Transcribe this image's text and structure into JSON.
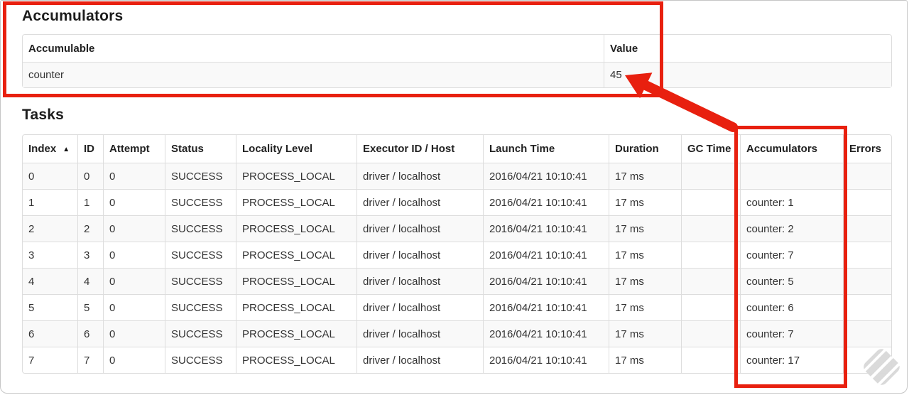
{
  "accumulators_section": {
    "title": "Accumulators",
    "table": {
      "headers": {
        "accumulable": "Accumulable",
        "value": "Value"
      },
      "rows": [
        {
          "accumulable": "counter",
          "value": "45"
        }
      ]
    }
  },
  "tasks_section": {
    "title": "Tasks",
    "table": {
      "headers": {
        "index": "Index",
        "id": "ID",
        "attempt": "Attempt",
        "status": "Status",
        "locality_level": "Locality Level",
        "executor_id_host": "Executor ID / Host",
        "launch_time": "Launch Time",
        "duration": "Duration",
        "gc_time": "GC Time",
        "accumulators": "Accumulators",
        "errors": "Errors"
      },
      "rows": [
        {
          "index": "0",
          "id": "0",
          "attempt": "0",
          "status": "SUCCESS",
          "locality_level": "PROCESS_LOCAL",
          "executor_id_host": "driver / localhost",
          "launch_time": "2016/04/21 10:10:41",
          "duration": "17 ms",
          "gc_time": "",
          "accumulators": "",
          "errors": ""
        },
        {
          "index": "1",
          "id": "1",
          "attempt": "0",
          "status": "SUCCESS",
          "locality_level": "PROCESS_LOCAL",
          "executor_id_host": "driver / localhost",
          "launch_time": "2016/04/21 10:10:41",
          "duration": "17 ms",
          "gc_time": "",
          "accumulators": "counter: 1",
          "errors": ""
        },
        {
          "index": "2",
          "id": "2",
          "attempt": "0",
          "status": "SUCCESS",
          "locality_level": "PROCESS_LOCAL",
          "executor_id_host": "driver / localhost",
          "launch_time": "2016/04/21 10:10:41",
          "duration": "17 ms",
          "gc_time": "",
          "accumulators": "counter: 2",
          "errors": ""
        },
        {
          "index": "3",
          "id": "3",
          "attempt": "0",
          "status": "SUCCESS",
          "locality_level": "PROCESS_LOCAL",
          "executor_id_host": "driver / localhost",
          "launch_time": "2016/04/21 10:10:41",
          "duration": "17 ms",
          "gc_time": "",
          "accumulators": "counter: 7",
          "errors": ""
        },
        {
          "index": "4",
          "id": "4",
          "attempt": "0",
          "status": "SUCCESS",
          "locality_level": "PROCESS_LOCAL",
          "executor_id_host": "driver / localhost",
          "launch_time": "2016/04/21 10:10:41",
          "duration": "17 ms",
          "gc_time": "",
          "accumulators": "counter: 5",
          "errors": ""
        },
        {
          "index": "5",
          "id": "5",
          "attempt": "0",
          "status": "SUCCESS",
          "locality_level": "PROCESS_LOCAL",
          "executor_id_host": "driver / localhost",
          "launch_time": "2016/04/21 10:10:41",
          "duration": "17 ms",
          "gc_time": "",
          "accumulators": "counter: 6",
          "errors": ""
        },
        {
          "index": "6",
          "id": "6",
          "attempt": "0",
          "status": "SUCCESS",
          "locality_level": "PROCESS_LOCAL",
          "executor_id_host": "driver / localhost",
          "launch_time": "2016/04/21 10:10:41",
          "duration": "17 ms",
          "gc_time": "",
          "accumulators": "counter: 7",
          "errors": ""
        },
        {
          "index": "7",
          "id": "7",
          "attempt": "0",
          "status": "SUCCESS",
          "locality_level": "PROCESS_LOCAL",
          "executor_id_host": "driver / localhost",
          "launch_time": "2016/04/21 10:10:41",
          "duration": "17 ms",
          "gc_time": "",
          "accumulators": "counter: 17",
          "errors": ""
        }
      ]
    }
  },
  "icons": {
    "sort_ascending": "▲",
    "watermark": "feedly-logo"
  },
  "colors": {
    "annotation_red": "#e8200f",
    "stripe": "#f9f9f9",
    "table_border": "#dddddd"
  }
}
